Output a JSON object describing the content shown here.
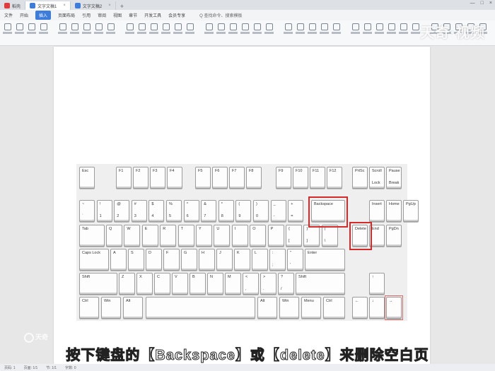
{
  "tabs": [
    {
      "label": "稻壳",
      "color": "#e23b3b"
    },
    {
      "label": "文字文稿1",
      "color": "#3c7ddc"
    },
    {
      "label": "文字文稿2",
      "color": "#3c7ddc"
    }
  ],
  "menu": [
    "文件",
    "开始",
    "插入",
    "页面布局",
    "引用",
    "审阅",
    "视图",
    "章节",
    "开发工具",
    "会员专享"
  ],
  "menu_active_index": 2,
  "search_text": "Q 查找命令、搜索模板",
  "watermark": "天奇·视频",
  "keys": {
    "esc": "Esc",
    "f": [
      "F1",
      "F2",
      "F3",
      "F4",
      "F5",
      "F6",
      "F7",
      "F8",
      "F9",
      "F10",
      "F11",
      "F12"
    ],
    "prtsc": "PrtSc",
    "scroll": [
      "Scroll",
      "Lock"
    ],
    "pause": [
      "Pause",
      "Break"
    ],
    "num_top": [
      "~",
      "!",
      "@",
      "#",
      "$",
      "%",
      "^",
      "&",
      "*",
      "(",
      ")",
      "_",
      "+"
    ],
    "num_bot": [
      "`",
      "1",
      "2",
      "3",
      "4",
      "5",
      "6",
      "7",
      "8",
      "9",
      "0",
      "-",
      "="
    ],
    "backspace": "Backspace",
    "insert": "Insert",
    "home": "Home",
    "pgup": "PgUp",
    "tab": "Tab",
    "qrow": [
      "Q",
      "W",
      "E",
      "R",
      "T",
      "Y",
      "U",
      "I",
      "O",
      "P"
    ],
    "bracket_top": [
      "{",
      "}",
      "|"
    ],
    "bracket_bot": [
      "[",
      "]",
      "\\"
    ],
    "delete": "Delete",
    "end": "End",
    "pgdn": "PgDn",
    "caps": "Caps Lock",
    "arow": [
      "A",
      "S",
      "D",
      "F",
      "G",
      "H",
      "J",
      "K",
      "L"
    ],
    "semi_top": [
      ":",
      "\""
    ],
    "semi_bot": [
      ";",
      "'"
    ],
    "enter": "Enter",
    "shift": "Shift",
    "zrow": [
      "Z",
      "X",
      "C",
      "V",
      "B",
      "N",
      "M"
    ],
    "punct_top": [
      "<",
      ">",
      "?"
    ],
    "punct_bot": [
      ",",
      ".",
      "/"
    ],
    "up": "↑",
    "ctrl": "Ctrl",
    "win": "Win",
    "alt": "Alt",
    "menu": "Menu",
    "left": "←",
    "down": "↓",
    "right": "→"
  },
  "subtitle": "按下键盘的【Backspace】或【delete】来删除空白页",
  "bottom_logo": "天奇",
  "status": [
    "页码: 1",
    "页面: 1/1",
    "节: 1/1",
    "字数: 0"
  ]
}
